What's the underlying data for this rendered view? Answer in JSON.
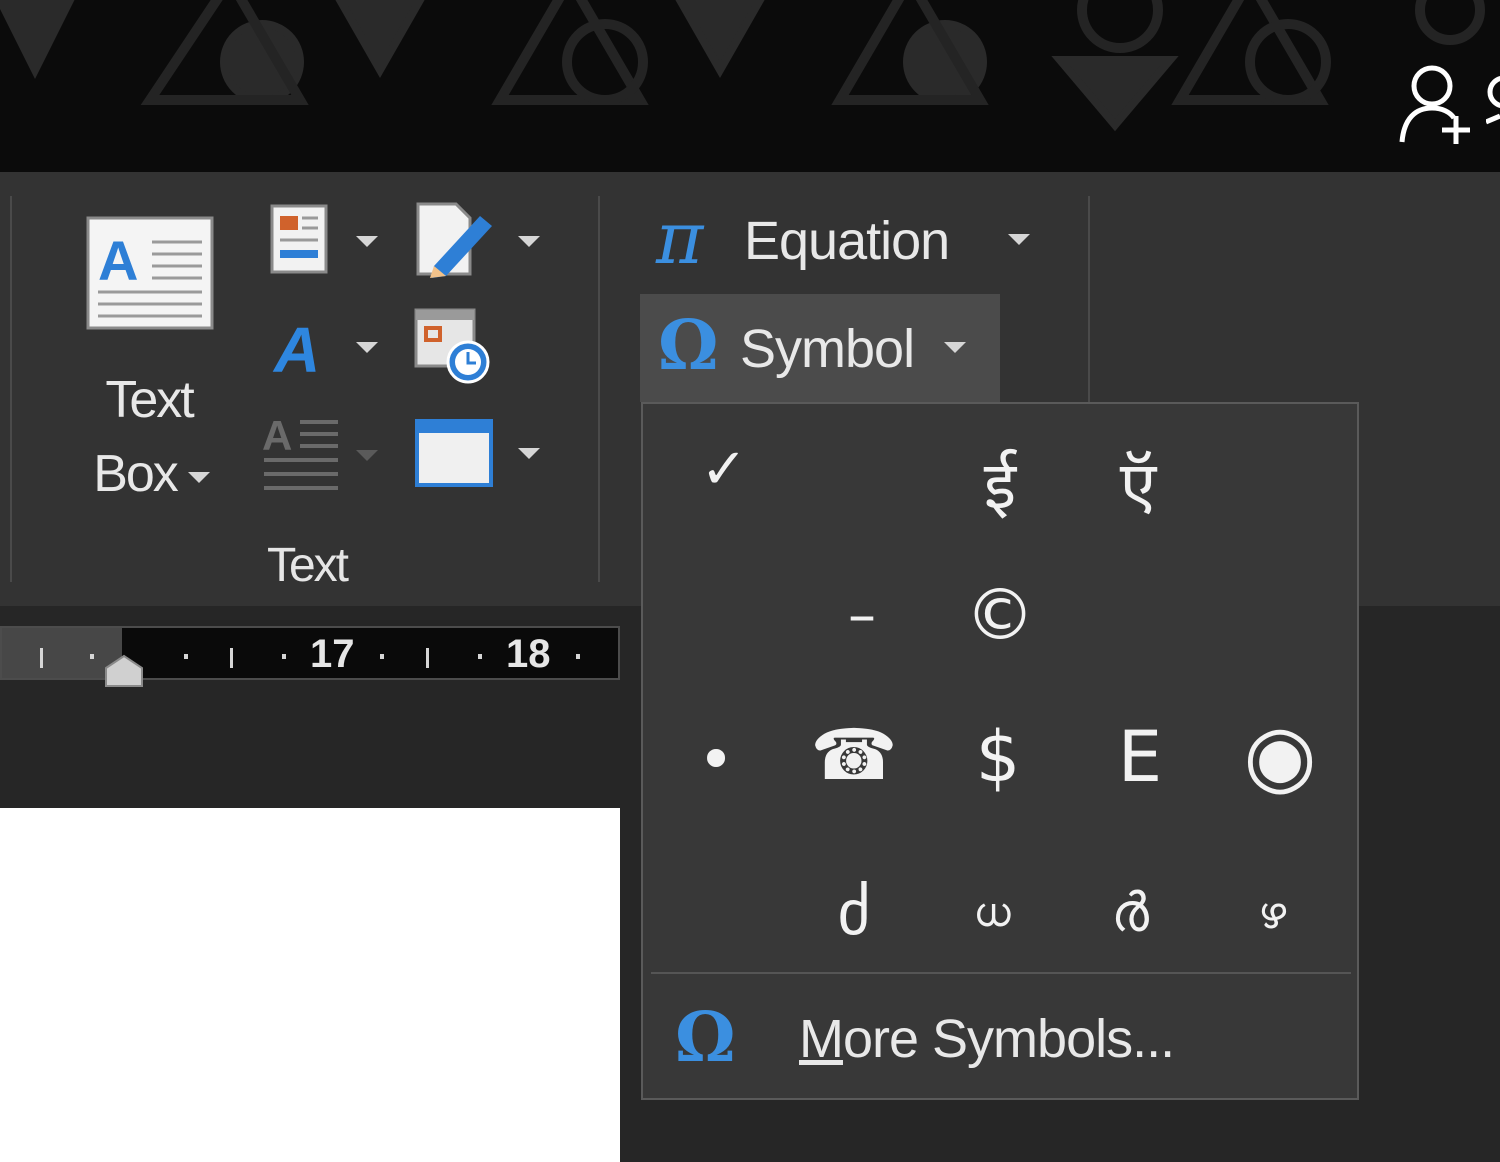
{
  "ribbon": {
    "text_box": {
      "line1": "Text",
      "line2": "Box"
    },
    "group_label": "Text",
    "equation": {
      "icon": "pi-icon",
      "icon_glyph": "π",
      "label": "Equation"
    },
    "symbol": {
      "icon": "omega-icon",
      "icon_glyph": "Ω",
      "label": "Symbol"
    }
  },
  "ruler": {
    "numbers": [
      "17",
      "18"
    ]
  },
  "symbol_menu": {
    "symbols": [
      "✓",
      "ई",
      "ऍ",
      "–",
      "©",
      "•",
      "☎",
      "$",
      "E",
      "◉",
      "ძ",
      "ധ",
      "ർ",
      "ഴ"
    ],
    "more_icon_glyph": "Ω",
    "more_label_underlined": "M",
    "more_label_rest": "ore Symbols..."
  },
  "colors": {
    "accent": "#3b8fe0",
    "ribbon_bg": "#333333",
    "menu_bg": "#383838",
    "titlebar_bg": "#0b0b0b"
  }
}
